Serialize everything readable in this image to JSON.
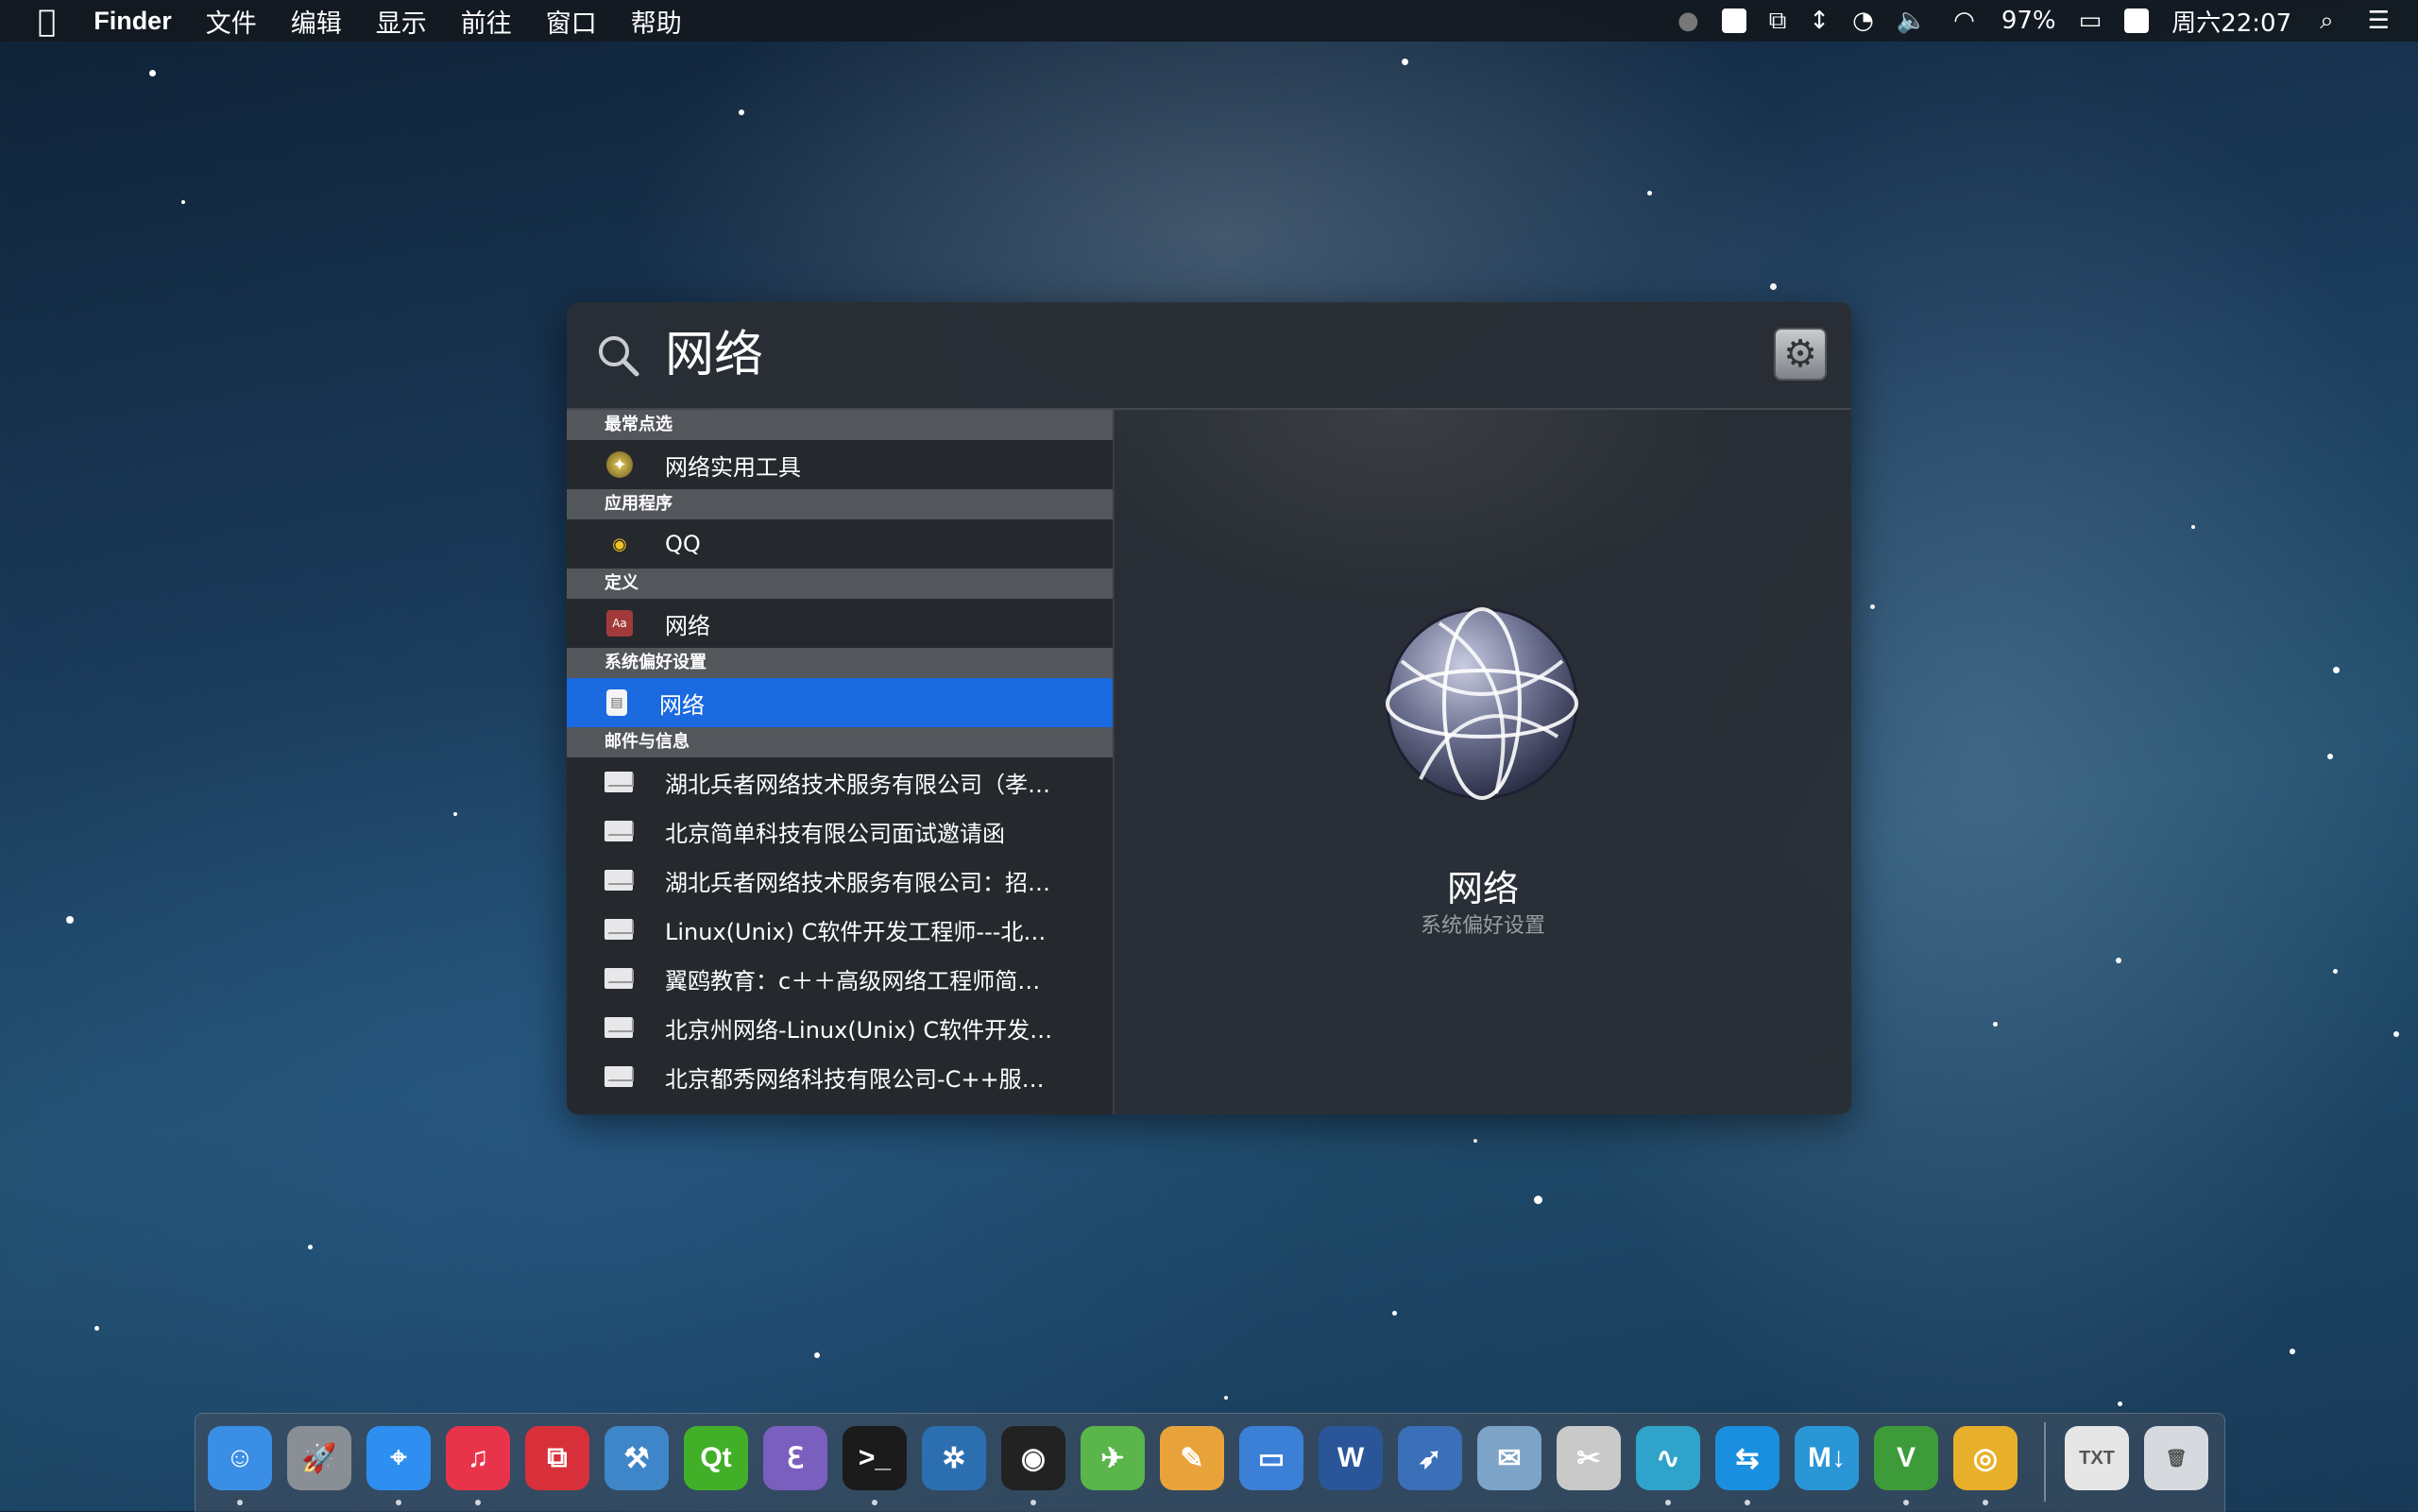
{
  "menubar": {
    "app_name": "Finder",
    "menus": [
      "文件",
      "编辑",
      "显示",
      "前往",
      "窗口",
      "帮助"
    ],
    "battery": "97%",
    "clock": "周六22:07"
  },
  "spotlight": {
    "query": "网络",
    "sections": [
      {
        "header": "最常点选",
        "items": [
          {
            "label": "网络实用工具",
            "icon": "network-utility-icon",
            "selected": false
          }
        ]
      },
      {
        "header": "应用程序",
        "items": [
          {
            "label": "QQ",
            "icon": "qq-penguin-icon",
            "selected": false
          }
        ]
      },
      {
        "header": "定义",
        "items": [
          {
            "label": "网络",
            "icon": "dictionary-icon",
            "selected": false
          }
        ]
      },
      {
        "header": "系统偏好设置",
        "items": [
          {
            "label": "网络",
            "icon": "preference-file-icon",
            "selected": true
          }
        ]
      },
      {
        "header": "邮件与信息",
        "items": [
          {
            "label": "湖北兵者网络技术服务有限公司（孝…",
            "icon": "envelope-icon"
          },
          {
            "label": "北京简单科技有限公司面试邀请函",
            "icon": "envelope-icon"
          },
          {
            "label": "湖北兵者网络技术服务有限公司：招…",
            "icon": "envelope-icon"
          },
          {
            "label": "Linux(Unix) C软件开发工程师---北…",
            "icon": "envelope-icon"
          },
          {
            "label": "翼鸥教育：c＋＋高级网络工程师简…",
            "icon": "envelope-icon"
          },
          {
            "label": "北京州网络-Linux(Unix) C软件开发…",
            "icon": "envelope-icon"
          },
          {
            "label": "北京都秀网络科技有限公司-C++服…",
            "icon": "envelope-icon"
          }
        ]
      }
    ],
    "preview": {
      "title": "网络",
      "subtitle": "系统偏好设置",
      "icon": "network-globe-icon"
    }
  },
  "dock": {
    "apps": [
      {
        "name": "finder-icon",
        "glyph": "☺",
        "color": "#3a8ee6",
        "running": true
      },
      {
        "name": "launchpad-icon",
        "glyph": "🚀",
        "color": "#8a8f96",
        "running": false
      },
      {
        "name": "safari-icon",
        "glyph": "⌖",
        "color": "#2f8ff0",
        "running": true
      },
      {
        "name": "itunes-icon",
        "glyph": "♫",
        "color": "#e8344a",
        "running": true
      },
      {
        "name": "parallels-icon",
        "glyph": "⧉",
        "color": "#d8303a",
        "running": false
      },
      {
        "name": "xcode-icon",
        "glyph": "⚒",
        "color": "#3f86c9",
        "running": false
      },
      {
        "name": "qt-creator-icon",
        "glyph": "Qt",
        "color": "#41b028",
        "running": false
      },
      {
        "name": "emacs-icon",
        "glyph": "ℇ",
        "color": "#7a5fbf",
        "running": false
      },
      {
        "name": "terminal-icon",
        "glyph": ">_",
        "color": "#1b1b1b",
        "running": true
      },
      {
        "name": "sourcetree-icon",
        "glyph": "✲",
        "color": "#2c6fb0",
        "running": false
      },
      {
        "name": "qq-icon",
        "glyph": "◉",
        "color": "#222222",
        "running": true
      },
      {
        "name": "maps-icon",
        "glyph": "✈",
        "color": "#5ab54a",
        "running": false
      },
      {
        "name": "pages-icon",
        "glyph": "✎",
        "color": "#e9a33b",
        "running": false
      },
      {
        "name": "keynote-icon",
        "glyph": "▭",
        "color": "#3c7fd6",
        "running": false
      },
      {
        "name": "word-icon",
        "glyph": "W",
        "color": "#2a5699",
        "running": false
      },
      {
        "name": "bird-app-icon",
        "glyph": "➶",
        "color": "#3b6fb8",
        "running": false
      },
      {
        "name": "preview-icon",
        "glyph": "✉",
        "color": "#7da3c7",
        "running": false
      },
      {
        "name": "screenshot-icon",
        "glyph": "✂",
        "color": "#c9c9c9",
        "running": false
      },
      {
        "name": "waveform-icon",
        "glyph": "∿",
        "color": "#2fa3c9",
        "running": true
      },
      {
        "name": "teamviewer-icon",
        "glyph": "⇆",
        "color": "#1a8fe0",
        "running": true
      },
      {
        "name": "markdown-icon",
        "glyph": "M↓",
        "color": "#2a96d6",
        "running": false
      },
      {
        "name": "vim-icon",
        "glyph": "V",
        "color": "#3e9b3a",
        "running": true
      },
      {
        "name": "chrome-icon",
        "glyph": "◎",
        "color": "#e8b02a",
        "running": true
      },
      {
        "name": "txt-document-icon",
        "glyph": "TXT",
        "color": "#e6e6e6",
        "running": false
      },
      {
        "name": "trash-icon",
        "glyph": "🗑",
        "color": "#d6dadf",
        "running": false
      }
    ]
  }
}
